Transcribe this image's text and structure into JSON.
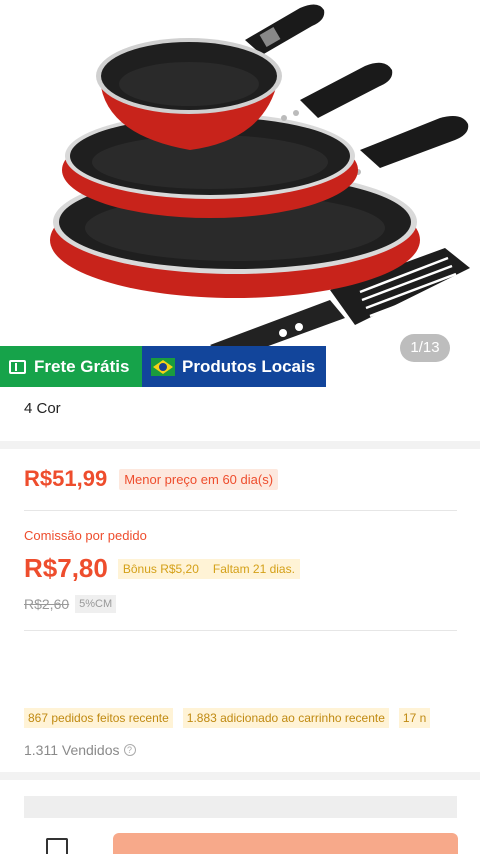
{
  "gallery": {
    "counter": "1/13",
    "image_alt": "Conjunto de frigideiras vermelhas com espátula"
  },
  "badges": {
    "frete": "Frete Grátis",
    "local": "Produtos Locais"
  },
  "variant": {
    "colors": "4 Cor"
  },
  "pricing": {
    "price": "R$51,99",
    "lowest_tag": "Menor preço em 60 dia(s)",
    "commission_label": "Comissão por pedido",
    "commission_price": "R$7,80",
    "bonus": "Bônus R$5,20",
    "days_left": "Faltam 21 dias.",
    "old_commission": "R$2,60",
    "cm_tag": "5%CM"
  },
  "stats": {
    "orders": "867 pedidos feitos recente",
    "added_cart": "1.883 adicionado ao carrinho recente",
    "partial": "17 n",
    "sold": "1.311 Vendidos",
    "help_icon": "?"
  },
  "colors": {
    "accent": "#ee4d2d",
    "frete": "#16a34a",
    "local": "#12459b",
    "pan_red": "#c8231b"
  }
}
